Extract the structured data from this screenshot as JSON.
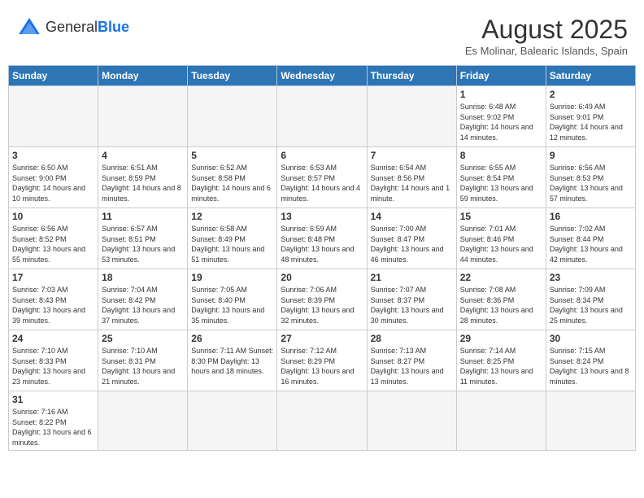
{
  "header": {
    "logo_general": "General",
    "logo_blue": "Blue",
    "month_title": "August 2025",
    "subtitle": "Es Molinar, Balearic Islands, Spain"
  },
  "weekdays": [
    "Sunday",
    "Monday",
    "Tuesday",
    "Wednesday",
    "Thursday",
    "Friday",
    "Saturday"
  ],
  "weeks": [
    [
      {
        "day": "",
        "info": ""
      },
      {
        "day": "",
        "info": ""
      },
      {
        "day": "",
        "info": ""
      },
      {
        "day": "",
        "info": ""
      },
      {
        "day": "",
        "info": ""
      },
      {
        "day": "1",
        "info": "Sunrise: 6:48 AM\nSunset: 9:02 PM\nDaylight: 14 hours and 14 minutes."
      },
      {
        "day": "2",
        "info": "Sunrise: 6:49 AM\nSunset: 9:01 PM\nDaylight: 14 hours and 12 minutes."
      }
    ],
    [
      {
        "day": "3",
        "info": "Sunrise: 6:50 AM\nSunset: 9:00 PM\nDaylight: 14 hours and 10 minutes."
      },
      {
        "day": "4",
        "info": "Sunrise: 6:51 AM\nSunset: 8:59 PM\nDaylight: 14 hours and 8 minutes."
      },
      {
        "day": "5",
        "info": "Sunrise: 6:52 AM\nSunset: 8:58 PM\nDaylight: 14 hours and 6 minutes."
      },
      {
        "day": "6",
        "info": "Sunrise: 6:53 AM\nSunset: 8:57 PM\nDaylight: 14 hours and 4 minutes."
      },
      {
        "day": "7",
        "info": "Sunrise: 6:54 AM\nSunset: 8:56 PM\nDaylight: 14 hours and 1 minute."
      },
      {
        "day": "8",
        "info": "Sunrise: 6:55 AM\nSunset: 8:54 PM\nDaylight: 13 hours and 59 minutes."
      },
      {
        "day": "9",
        "info": "Sunrise: 6:56 AM\nSunset: 8:53 PM\nDaylight: 13 hours and 57 minutes."
      }
    ],
    [
      {
        "day": "10",
        "info": "Sunrise: 6:56 AM\nSunset: 8:52 PM\nDaylight: 13 hours and 55 minutes."
      },
      {
        "day": "11",
        "info": "Sunrise: 6:57 AM\nSunset: 8:51 PM\nDaylight: 13 hours and 53 minutes."
      },
      {
        "day": "12",
        "info": "Sunrise: 6:58 AM\nSunset: 8:49 PM\nDaylight: 13 hours and 51 minutes."
      },
      {
        "day": "13",
        "info": "Sunrise: 6:59 AM\nSunset: 8:48 PM\nDaylight: 13 hours and 48 minutes."
      },
      {
        "day": "14",
        "info": "Sunrise: 7:00 AM\nSunset: 8:47 PM\nDaylight: 13 hours and 46 minutes."
      },
      {
        "day": "15",
        "info": "Sunrise: 7:01 AM\nSunset: 8:46 PM\nDaylight: 13 hours and 44 minutes."
      },
      {
        "day": "16",
        "info": "Sunrise: 7:02 AM\nSunset: 8:44 PM\nDaylight: 13 hours and 42 minutes."
      }
    ],
    [
      {
        "day": "17",
        "info": "Sunrise: 7:03 AM\nSunset: 8:43 PM\nDaylight: 13 hours and 39 minutes."
      },
      {
        "day": "18",
        "info": "Sunrise: 7:04 AM\nSunset: 8:42 PM\nDaylight: 13 hours and 37 minutes."
      },
      {
        "day": "19",
        "info": "Sunrise: 7:05 AM\nSunset: 8:40 PM\nDaylight: 13 hours and 35 minutes."
      },
      {
        "day": "20",
        "info": "Sunrise: 7:06 AM\nSunset: 8:39 PM\nDaylight: 13 hours and 32 minutes."
      },
      {
        "day": "21",
        "info": "Sunrise: 7:07 AM\nSunset: 8:37 PM\nDaylight: 13 hours and 30 minutes."
      },
      {
        "day": "22",
        "info": "Sunrise: 7:08 AM\nSunset: 8:36 PM\nDaylight: 13 hours and 28 minutes."
      },
      {
        "day": "23",
        "info": "Sunrise: 7:09 AM\nSunset: 8:34 PM\nDaylight: 13 hours and 25 minutes."
      }
    ],
    [
      {
        "day": "24",
        "info": "Sunrise: 7:10 AM\nSunset: 8:33 PM\nDaylight: 13 hours and 23 minutes."
      },
      {
        "day": "25",
        "info": "Sunrise: 7:10 AM\nSunset: 8:31 PM\nDaylight: 13 hours and 21 minutes."
      },
      {
        "day": "26",
        "info": "Sunrise: 7:11 AM\nSunset: 8:30 PM\nDaylight: 13 hours and 18 minutes."
      },
      {
        "day": "27",
        "info": "Sunrise: 7:12 AM\nSunset: 8:29 PM\nDaylight: 13 hours and 16 minutes."
      },
      {
        "day": "28",
        "info": "Sunrise: 7:13 AM\nSunset: 8:27 PM\nDaylight: 13 hours and 13 minutes."
      },
      {
        "day": "29",
        "info": "Sunrise: 7:14 AM\nSunset: 8:25 PM\nDaylight: 13 hours and 11 minutes."
      },
      {
        "day": "30",
        "info": "Sunrise: 7:15 AM\nSunset: 8:24 PM\nDaylight: 13 hours and 8 minutes."
      }
    ],
    [
      {
        "day": "31",
        "info": "Sunrise: 7:16 AM\nSunset: 8:22 PM\nDaylight: 13 hours and 6 minutes."
      },
      {
        "day": "",
        "info": ""
      },
      {
        "day": "",
        "info": ""
      },
      {
        "day": "",
        "info": ""
      },
      {
        "day": "",
        "info": ""
      },
      {
        "day": "",
        "info": ""
      },
      {
        "day": "",
        "info": ""
      }
    ]
  ]
}
